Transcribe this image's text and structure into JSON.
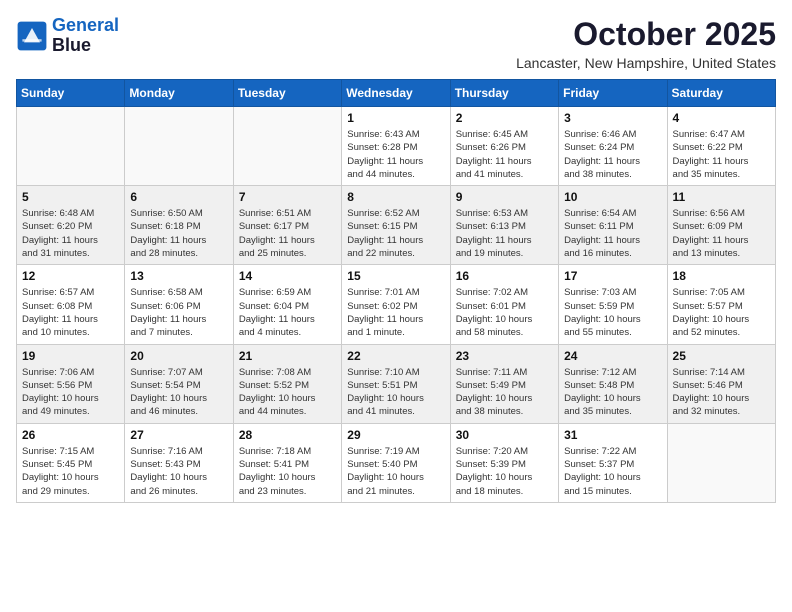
{
  "header": {
    "logo_line1": "General",
    "logo_line2": "Blue",
    "month": "October 2025",
    "location": "Lancaster, New Hampshire, United States"
  },
  "weekdays": [
    "Sunday",
    "Monday",
    "Tuesday",
    "Wednesday",
    "Thursday",
    "Friday",
    "Saturday"
  ],
  "weeks": [
    [
      {
        "day": "",
        "info": ""
      },
      {
        "day": "",
        "info": ""
      },
      {
        "day": "",
        "info": ""
      },
      {
        "day": "1",
        "info": "Sunrise: 6:43 AM\nSunset: 6:28 PM\nDaylight: 11 hours\nand 44 minutes."
      },
      {
        "day": "2",
        "info": "Sunrise: 6:45 AM\nSunset: 6:26 PM\nDaylight: 11 hours\nand 41 minutes."
      },
      {
        "day": "3",
        "info": "Sunrise: 6:46 AM\nSunset: 6:24 PM\nDaylight: 11 hours\nand 38 minutes."
      },
      {
        "day": "4",
        "info": "Sunrise: 6:47 AM\nSunset: 6:22 PM\nDaylight: 11 hours\nand 35 minutes."
      }
    ],
    [
      {
        "day": "5",
        "info": "Sunrise: 6:48 AM\nSunset: 6:20 PM\nDaylight: 11 hours\nand 31 minutes."
      },
      {
        "day": "6",
        "info": "Sunrise: 6:50 AM\nSunset: 6:18 PM\nDaylight: 11 hours\nand 28 minutes."
      },
      {
        "day": "7",
        "info": "Sunrise: 6:51 AM\nSunset: 6:17 PM\nDaylight: 11 hours\nand 25 minutes."
      },
      {
        "day": "8",
        "info": "Sunrise: 6:52 AM\nSunset: 6:15 PM\nDaylight: 11 hours\nand 22 minutes."
      },
      {
        "day": "9",
        "info": "Sunrise: 6:53 AM\nSunset: 6:13 PM\nDaylight: 11 hours\nand 19 minutes."
      },
      {
        "day": "10",
        "info": "Sunrise: 6:54 AM\nSunset: 6:11 PM\nDaylight: 11 hours\nand 16 minutes."
      },
      {
        "day": "11",
        "info": "Sunrise: 6:56 AM\nSunset: 6:09 PM\nDaylight: 11 hours\nand 13 minutes."
      }
    ],
    [
      {
        "day": "12",
        "info": "Sunrise: 6:57 AM\nSunset: 6:08 PM\nDaylight: 11 hours\nand 10 minutes."
      },
      {
        "day": "13",
        "info": "Sunrise: 6:58 AM\nSunset: 6:06 PM\nDaylight: 11 hours\nand 7 minutes."
      },
      {
        "day": "14",
        "info": "Sunrise: 6:59 AM\nSunset: 6:04 PM\nDaylight: 11 hours\nand 4 minutes."
      },
      {
        "day": "15",
        "info": "Sunrise: 7:01 AM\nSunset: 6:02 PM\nDaylight: 11 hours\nand 1 minute."
      },
      {
        "day": "16",
        "info": "Sunrise: 7:02 AM\nSunset: 6:01 PM\nDaylight: 10 hours\nand 58 minutes."
      },
      {
        "day": "17",
        "info": "Sunrise: 7:03 AM\nSunset: 5:59 PM\nDaylight: 10 hours\nand 55 minutes."
      },
      {
        "day": "18",
        "info": "Sunrise: 7:05 AM\nSunset: 5:57 PM\nDaylight: 10 hours\nand 52 minutes."
      }
    ],
    [
      {
        "day": "19",
        "info": "Sunrise: 7:06 AM\nSunset: 5:56 PM\nDaylight: 10 hours\nand 49 minutes."
      },
      {
        "day": "20",
        "info": "Sunrise: 7:07 AM\nSunset: 5:54 PM\nDaylight: 10 hours\nand 46 minutes."
      },
      {
        "day": "21",
        "info": "Sunrise: 7:08 AM\nSunset: 5:52 PM\nDaylight: 10 hours\nand 44 minutes."
      },
      {
        "day": "22",
        "info": "Sunrise: 7:10 AM\nSunset: 5:51 PM\nDaylight: 10 hours\nand 41 minutes."
      },
      {
        "day": "23",
        "info": "Sunrise: 7:11 AM\nSunset: 5:49 PM\nDaylight: 10 hours\nand 38 minutes."
      },
      {
        "day": "24",
        "info": "Sunrise: 7:12 AM\nSunset: 5:48 PM\nDaylight: 10 hours\nand 35 minutes."
      },
      {
        "day": "25",
        "info": "Sunrise: 7:14 AM\nSunset: 5:46 PM\nDaylight: 10 hours\nand 32 minutes."
      }
    ],
    [
      {
        "day": "26",
        "info": "Sunrise: 7:15 AM\nSunset: 5:45 PM\nDaylight: 10 hours\nand 29 minutes."
      },
      {
        "day": "27",
        "info": "Sunrise: 7:16 AM\nSunset: 5:43 PM\nDaylight: 10 hours\nand 26 minutes."
      },
      {
        "day": "28",
        "info": "Sunrise: 7:18 AM\nSunset: 5:41 PM\nDaylight: 10 hours\nand 23 minutes."
      },
      {
        "day": "29",
        "info": "Sunrise: 7:19 AM\nSunset: 5:40 PM\nDaylight: 10 hours\nand 21 minutes."
      },
      {
        "day": "30",
        "info": "Sunrise: 7:20 AM\nSunset: 5:39 PM\nDaylight: 10 hours\nand 18 minutes."
      },
      {
        "day": "31",
        "info": "Sunrise: 7:22 AM\nSunset: 5:37 PM\nDaylight: 10 hours\nand 15 minutes."
      },
      {
        "day": "",
        "info": ""
      }
    ]
  ]
}
